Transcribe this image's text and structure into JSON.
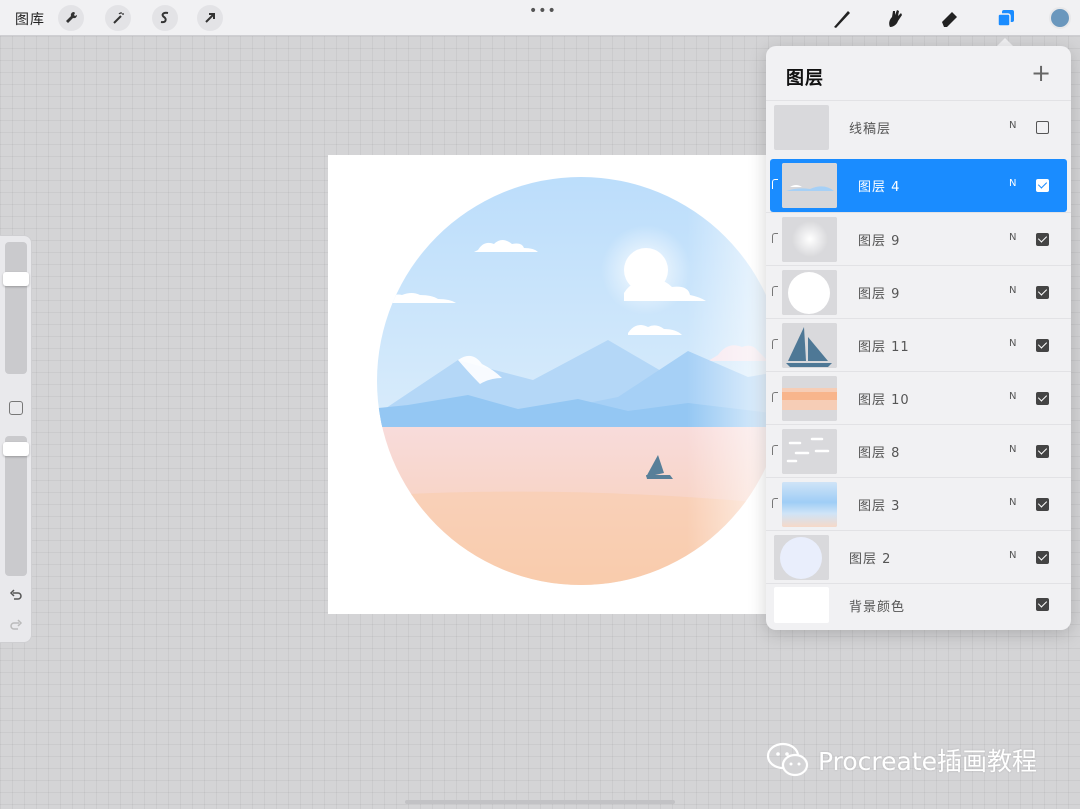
{
  "topbar": {
    "gallery_label": "图库",
    "more_dots": "•••",
    "tools_left": [
      {
        "icon": "wrench-icon"
      },
      {
        "icon": "magic-wand-icon"
      },
      {
        "icon": "selection-icon"
      },
      {
        "icon": "transform-arrow-icon"
      }
    ],
    "tools_right": [
      {
        "icon": "brush-icon"
      },
      {
        "icon": "smudge-icon"
      },
      {
        "icon": "eraser-icon"
      },
      {
        "icon": "layers-icon",
        "active": true
      }
    ],
    "current_color": "#6a97bd",
    "active_color": "#1a8cff"
  },
  "sidebar": {
    "brush_size_level": 0.75,
    "opacity_level": 0.05
  },
  "layers_panel": {
    "title": "图层",
    "add_symbol": "+",
    "layers": [
      {
        "name": "线稿层",
        "blend": "N",
        "visible": false,
        "selected": false,
        "clipped": false
      },
      {
        "name": "图层 4",
        "blend": "N",
        "visible": true,
        "selected": true,
        "clipped": true
      },
      {
        "name": "图层 9",
        "blend": "N",
        "visible": true,
        "selected": false,
        "clipped": true
      },
      {
        "name": "图层 9",
        "blend": "N",
        "visible": true,
        "selected": false,
        "clipped": true
      },
      {
        "name": "图层 11",
        "blend": "N",
        "visible": true,
        "selected": false,
        "clipped": true
      },
      {
        "name": "图层 10",
        "blend": "N",
        "visible": true,
        "selected": false,
        "clipped": true
      },
      {
        "name": "图层 8",
        "blend": "N",
        "visible": true,
        "selected": false,
        "clipped": true
      },
      {
        "name": "图层 3",
        "blend": "N",
        "visible": true,
        "selected": false,
        "clipped": true
      },
      {
        "name": "图层 2",
        "blend": "N",
        "visible": true,
        "selected": false,
        "clipped": false
      },
      {
        "name": "背景颜色",
        "blend": "",
        "visible": true,
        "selected": false,
        "clipped": false
      }
    ]
  },
  "watermark": {
    "text": "Procreate插画教程",
    "icon": "wechat-icon"
  }
}
